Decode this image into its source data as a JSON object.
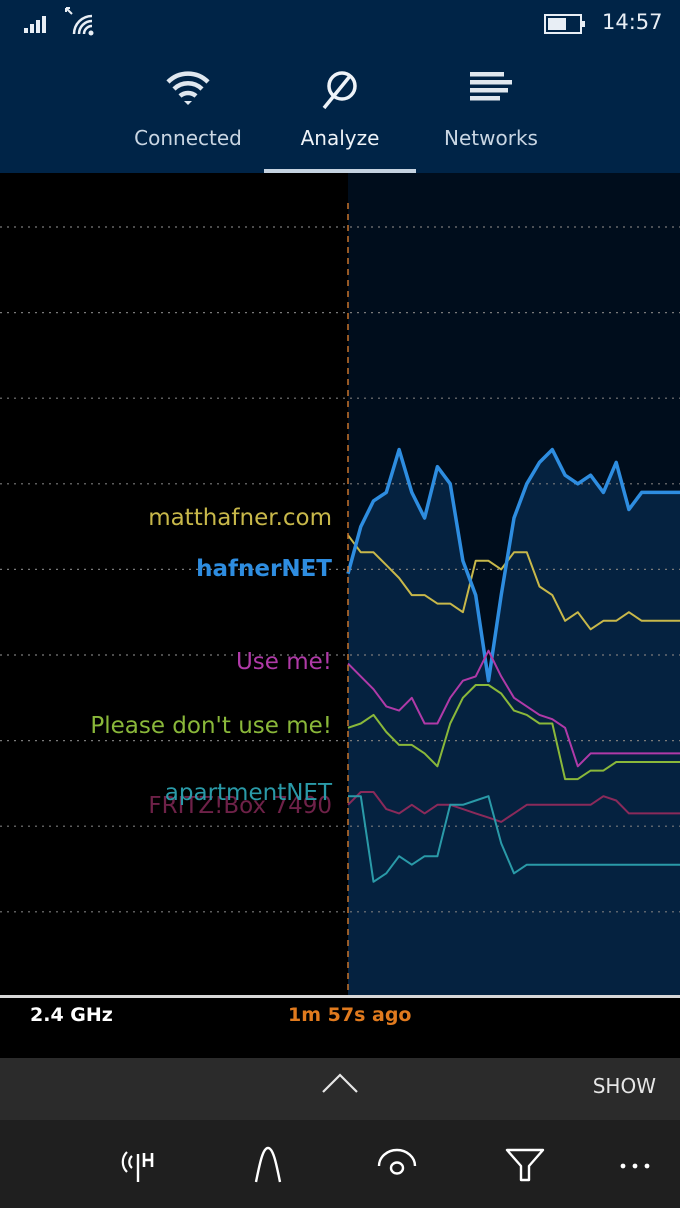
{
  "status_bar": {
    "signal_icon": "cellular-signal-icon",
    "wifi_icon": "wifi-roaming-icon",
    "battery_icon": "battery-icon",
    "battery_level": 0.6,
    "time": "14:57"
  },
  "nav": {
    "tabs": [
      {
        "label": "Connected",
        "icon": "wifi-icon",
        "active": false
      },
      {
        "label": "Analyze",
        "icon": "analyze-icon",
        "active": true
      },
      {
        "label": "Networks",
        "icon": "networks-list-icon",
        "active": false
      }
    ]
  },
  "chart_data": {
    "type": "line",
    "title": "",
    "xlabel": "",
    "ylabel": "",
    "grid": true,
    "x_count": 27,
    "ylim": [
      -100,
      -10
    ],
    "gridlines_y": [
      -20,
      -30,
      -40,
      -50,
      -60,
      -70,
      -80,
      -90,
      -100
    ],
    "cursor_label": "1m 57s ago",
    "series": [
      {
        "name": "matthafner.com",
        "color": "#c8b84a",
        "bold": false,
        "filled": false,
        "values": [
          -56,
          -58,
          -58,
          -59.5,
          -61,
          -63,
          -63,
          -64,
          -64,
          -65,
          -59,
          -59,
          -60,
          -58,
          -58,
          -62,
          -63,
          -66,
          -65,
          -67,
          -66,
          -66,
          -65,
          -66,
          -66,
          -66,
          -66
        ]
      },
      {
        "name": "hafnerNET",
        "color": "#2e8de0",
        "bold": true,
        "filled": true,
        "values": [
          -60.5,
          -55,
          -52,
          -51,
          -46,
          -51,
          -54,
          -48,
          -50,
          -59,
          -63,
          -73,
          -63,
          -54,
          -50,
          -47.5,
          -46,
          -49,
          -50,
          -49,
          -51,
          -47.5,
          -53,
          -51,
          -51,
          -51,
          -51
        ]
      },
      {
        "name": "Use me!",
        "color": "#b03aa8",
        "bold": false,
        "filled": false,
        "values": [
          -71,
          -72.5,
          -74,
          -76,
          -76.5,
          -75,
          -78,
          -78,
          -75,
          -73,
          -72.5,
          -69.5,
          -72.5,
          -75,
          -76,
          -77,
          -77.5,
          -78.5,
          -83,
          -81.5,
          -81.5,
          -81.5,
          -81.5,
          -81.5,
          -81.5,
          -81.5,
          -81.5
        ]
      },
      {
        "name": "Please don't use me!",
        "color": "#8ab83a",
        "bold": false,
        "filled": false,
        "values": [
          -78.5,
          -78,
          -77,
          -79,
          -80.5,
          -80.5,
          -81.5,
          -83,
          -78,
          -75,
          -73.5,
          -73.5,
          -74.5,
          -76.5,
          -77,
          -78,
          -78,
          -84.5,
          -84.5,
          -83.5,
          -83.5,
          -82.5,
          -82.5,
          -82.5,
          -82.5,
          -82.5,
          -82.5
        ]
      },
      {
        "name": "FRITZ!Box 7490",
        "color": "#8a2a5a",
        "bold": false,
        "filled": false,
        "values": [
          -87.5,
          -86,
          -86,
          -88,
          -88.5,
          -87.5,
          -88.5,
          -87.5,
          -87.5,
          -88,
          -88.5,
          -89,
          -89.5,
          -88.5,
          -87.5,
          -87.5,
          -87.5,
          -87.5,
          -87.5,
          -87.5,
          -86.5,
          -87,
          -88.5,
          -88.5,
          -88.5,
          -88.5,
          -88.5
        ]
      },
      {
        "name": "apartmentNET",
        "color": "#2a9aa8",
        "bold": false,
        "filled": false,
        "values": [
          -86.5,
          -86.5,
          -96.5,
          -95.5,
          -93.5,
          -94.5,
          -93.5,
          -93.5,
          -87.5,
          -87.5,
          -87,
          -86.5,
          -92,
          -95.5,
          -94.5,
          -94.5,
          -94.5,
          -94.5,
          -94.5,
          -94.5,
          -94.5,
          -94.5,
          -94.5,
          -94.5,
          -94.5,
          -94.5,
          -94.5
        ]
      }
    ]
  },
  "info_bar": {
    "band": "2.4 GHz",
    "time_ago": "1m 57s ago"
  },
  "app_bar": {
    "expand_icon": "chevron-up-icon",
    "show_label": "SHOW"
  },
  "command_bar": {
    "buttons": [
      {
        "name": "antenna-h-icon"
      },
      {
        "name": "channel-curve-icon"
      },
      {
        "name": "visibility-icon"
      },
      {
        "name": "filter-icon"
      },
      {
        "name": "more-icon"
      }
    ]
  }
}
